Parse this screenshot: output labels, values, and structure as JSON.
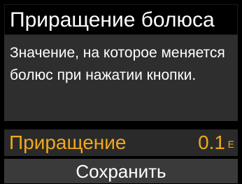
{
  "header": {
    "title": "Приращение болюса"
  },
  "description": {
    "text": "Значение, на которое меняется болюс при нажатии кнопки."
  },
  "setting": {
    "label": "Приращение",
    "value": "0.1",
    "unit": "Е"
  },
  "actions": {
    "save_label": "Сохранить"
  },
  "colors": {
    "accent": "#f0a81c",
    "background": "#000000",
    "panel": "#2e2e2e"
  }
}
